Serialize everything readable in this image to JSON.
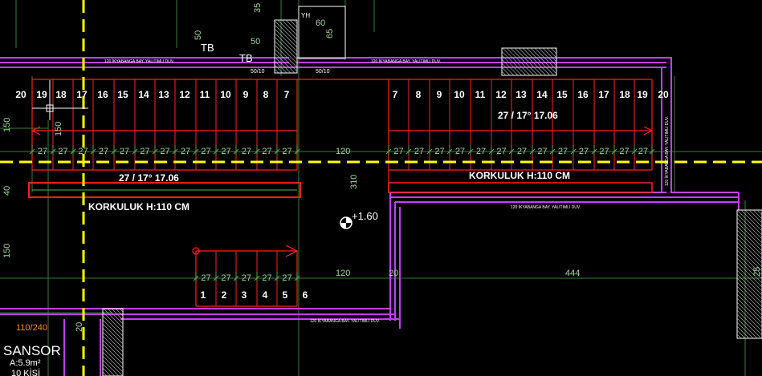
{
  "drawing": {
    "background": "#000000",
    "colors": {
      "stair": "#ff2020",
      "wall": "#c040ff",
      "dim": "#58b058",
      "axis": "#ffff00",
      "text": "#ffffff",
      "room": "#ff8c1a"
    },
    "steps_upper_left": [
      "20",
      "19",
      "18",
      "17",
      "16",
      "15",
      "14",
      "13",
      "12",
      "11",
      "10",
      "9",
      "8",
      "7"
    ],
    "steps_upper_right": [
      "7",
      "8",
      "9",
      "10",
      "11",
      "12",
      "13",
      "14",
      "15",
      "16",
      "17",
      "18",
      "19",
      "20"
    ],
    "steps_lower": [
      "1",
      "2",
      "3",
      "4",
      "5",
      "6"
    ],
    "stair_label_right": "27 / 17° 17.06",
    "stair_label_left": "27 / 17° 17.06",
    "handrail_right": "KORKULUK H:110 CM",
    "handrail_left": "KORKULUK H:110 CM",
    "level": "+1.60",
    "tread": "27",
    "landing_upper": "120",
    "landing_lower": "120",
    "dim_444": "444",
    "dim_310": "310",
    "dim_150_a": "150",
    "dim_150_b": "150",
    "dim_40": "40",
    "dim_20_a": "20",
    "dim_20_b": "20",
    "dim_25": "25",
    "dim_50_a": "50",
    "dim_50_b": "50",
    "dim_60": "60",
    "dim_65": "65",
    "dim_35": "35",
    "dim_150_small": "150",
    "tb_1": "TB",
    "tb_2": "TB",
    "yh": "YH",
    "wall_note": "120 İKYABANGA BAY. YALITIMLI DUV.",
    "room_name": "SANSOR",
    "room_area": "A:5.9m²",
    "room_people": "10 KİŞİ",
    "room_code": "110/240",
    "small_5010_a": "50/10",
    "small_5010_b": "50/10"
  }
}
